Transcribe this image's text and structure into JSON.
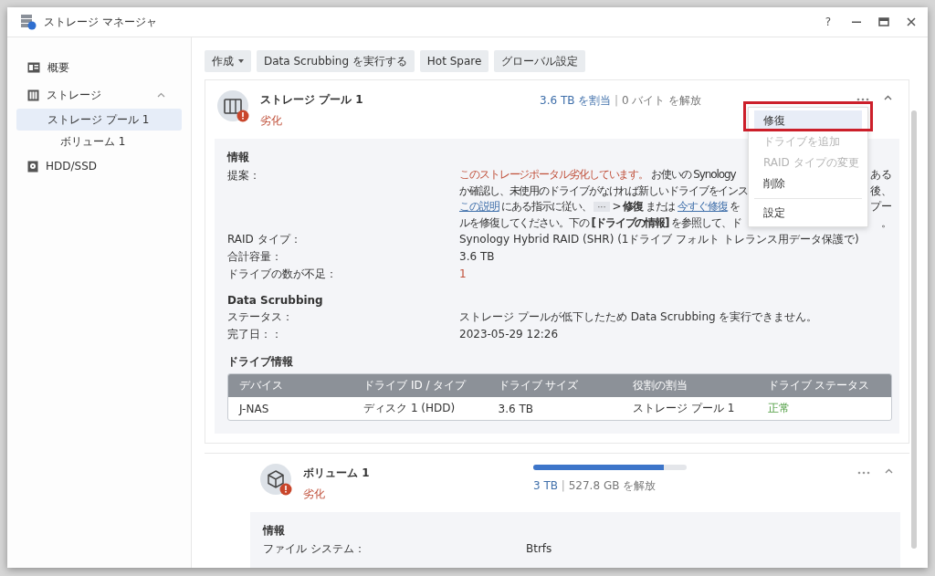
{
  "window": {
    "title": "ストレージ マネージャ",
    "help": "?"
  },
  "sidebar": {
    "items": [
      {
        "label": "概要",
        "selected": false
      },
      {
        "label": "ストレージ",
        "selected": false,
        "expanded": true,
        "children": [
          {
            "label": "ストレージ プール 1",
            "selected": true,
            "children": [
              {
                "label": "ボリューム 1",
                "selected": false
              }
            ]
          }
        ]
      },
      {
        "label": "HDD/SSD",
        "selected": false
      }
    ]
  },
  "toolbar": [
    {
      "label": "作成",
      "dropdown": true
    },
    {
      "label": "Data Scrubbing を実行する",
      "dropdown": false
    },
    {
      "label": "Hot Spare",
      "dropdown": false
    },
    {
      "label": "グローバル設定",
      "dropdown": false
    }
  ],
  "pool": {
    "name": "ストレージ プール 1",
    "status": "劣化",
    "allocated": "3.6 TB を割当",
    "divider": "|",
    "free": "0 バイト を解放",
    "expanded": true,
    "info_title": "情報",
    "suggestion_label": "提案：",
    "suggestion_lines": [
      {
        "left": [
          {
            "kind": "warn",
            "text": "このストレージポータル劣化しています。"
          },
          {
            "kind": "text",
            "text": " お使いの Synology"
          }
        ],
        "right": "ある"
      },
      {
        "left": [
          {
            "kind": "text",
            "text": "か確認し、未使用のドライブがなければ新しいドライブをインス"
          }
        ],
        "right": "後、"
      },
      {
        "left": [
          {
            "kind": "link",
            "text": "この説明"
          },
          {
            "kind": "text",
            "text": " にある指示に従い、 "
          },
          {
            "kind": "chip",
            "text": "···"
          },
          {
            "kind": "text",
            "text": " > **修復** または "
          },
          {
            "kind": "link",
            "text": "今すぐ修復"
          },
          {
            "kind": "text",
            "text": " を"
          }
        ],
        "right": "プー"
      },
      {
        "left": [
          {
            "kind": "text",
            "text": "ルを修復してください。下の **[ドライブの情報]** を参照して、ド"
          }
        ],
        "right": "。"
      }
    ],
    "info_rows": [
      {
        "label": "RAID タイプ：",
        "value": "Synology Hybrid RAID (SHR) (1ドライブ フォルト トレランス用データ保護で)",
        "warn": false
      },
      {
        "label": "合計容量：",
        "value": "3.6 TB",
        "warn": false
      },
      {
        "label": "ドライブの数が不足：",
        "value": "1",
        "warn": true
      }
    ],
    "scrub_title": "Data Scrubbing",
    "scrub_rows": [
      {
        "label": "ステータス：",
        "value": "ストレージ プールが低下したため Data Scrubbing を実行できません。"
      },
      {
        "label": "完了日：：",
        "value": "2023-05-29 12:26"
      }
    ],
    "drives_title": "ドライブ情報",
    "table": {
      "columns": [
        "デバイス",
        "ドライブ ID / タイプ",
        "ドライブ サイズ",
        "役割の割当",
        "ドライブ ステータス"
      ],
      "rows": [
        {
          "cells": [
            "J-NAS",
            "ディスク 1 (HDD)",
            "3.6 TB",
            "ストレージ プール 1",
            "正常"
          ],
          "status_ok": true
        }
      ]
    }
  },
  "menu": {
    "items": [
      {
        "label": "修復",
        "disabled": false,
        "selected": true,
        "highlighted": true
      },
      {
        "label": "ドライブを追加",
        "disabled": true,
        "selected": false,
        "highlighted": false
      },
      {
        "label": "RAID タイプの変更",
        "disabled": true,
        "selected": false,
        "highlighted": false
      },
      {
        "label": "削除",
        "disabled": false,
        "selected": false,
        "highlighted": false
      },
      {
        "label": "設定",
        "disabled": false,
        "selected": false,
        "highlighted": false,
        "separator_before": true
      }
    ]
  },
  "volume": {
    "name": "ボリューム 1",
    "status": "劣化",
    "level": 0.85,
    "used": "3 TB",
    "divider": "|",
    "free": "527.8 GB を解放",
    "expanded": true,
    "info_title": "情報",
    "info_rows": [
      {
        "label": "ファイル システム：",
        "value": "Btrfs"
      }
    ]
  }
}
